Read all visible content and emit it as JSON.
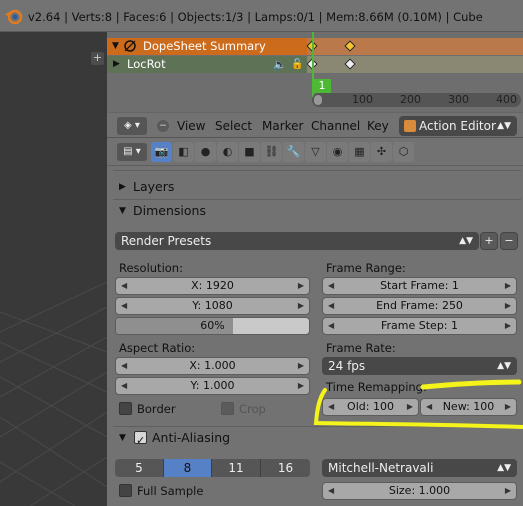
{
  "info_bar": {
    "text": "v2.64 | Verts:8 | Faces:6 | Objects:1/3 | Lamps:0/1 | Mem:8.66M (0.10M) | Cube"
  },
  "dopesheet": {
    "summary_label": "DopeSheet Summary",
    "channel_label": "LocRot",
    "current_frame": "1",
    "ruler_ticks": [
      "100",
      "200",
      "300",
      "400"
    ]
  },
  "dopesheet_header": {
    "menus": [
      "View",
      "Select",
      "Marker",
      "Channel",
      "Key"
    ],
    "mode_value": "Action Editor"
  },
  "properties": {
    "layers_title": "Layers",
    "dimensions_title": "Dimensions",
    "render_presets": "Render Presets",
    "resolution_label": "Resolution:",
    "res_x": "X: 1920",
    "res_y": "Y: 1080",
    "res_percent": "60%",
    "frame_range_label": "Frame Range:",
    "start_frame": "Start Frame: 1",
    "end_frame": "End Frame: 250",
    "frame_step": "Frame Step: 1",
    "aspect_label": "Aspect Ratio:",
    "aspect_x": "X: 1.000",
    "aspect_y": "Y: 1.000",
    "frame_rate_label": "Frame Rate:",
    "frame_rate_value": "24 fps",
    "border_label": "Border",
    "crop_label": "Crop",
    "time_remap_label": "Time Remapping:",
    "old_value": "Old: 100",
    "new_value": "New: 100",
    "aa_title": "Anti-Aliasing",
    "aa_samples": [
      "5",
      "8",
      "11",
      "16"
    ],
    "aa_selected": "8",
    "filter_value": "Mitchell-Netravali",
    "full_sample_label": "Full Sample",
    "size_value": "Size: 1.000"
  },
  "colors": {
    "highlight_yellow": "#f4f41a",
    "selected_blue": "#5681c7",
    "current_frame_green": "#4cb833"
  }
}
